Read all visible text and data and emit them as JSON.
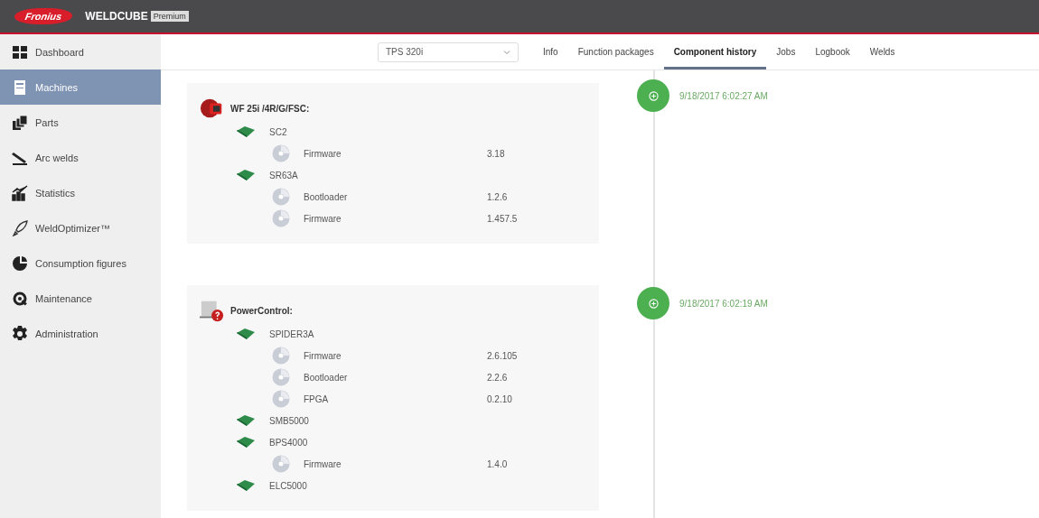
{
  "header": {
    "logo": "Fronius",
    "product": "WELDCUBE",
    "edition": "Premium"
  },
  "sidebar": {
    "items": [
      {
        "label": "Dashboard",
        "selected": false
      },
      {
        "label": "Machines",
        "selected": true
      },
      {
        "label": "Parts",
        "selected": false
      },
      {
        "label": "Arc welds",
        "selected": false
      },
      {
        "label": "Statistics",
        "selected": false
      },
      {
        "label": "WeldOptimizer™",
        "selected": false
      },
      {
        "label": "Consumption figures",
        "selected": false
      },
      {
        "label": "Maintenance",
        "selected": false
      },
      {
        "label": "Administration",
        "selected": false
      }
    ]
  },
  "machine_select": {
    "value": "TPS 320i"
  },
  "tabs": [
    {
      "label": "Info",
      "selected": false
    },
    {
      "label": "Function packages",
      "selected": false
    },
    {
      "label": "Component history",
      "selected": true
    },
    {
      "label": "Jobs",
      "selected": false
    },
    {
      "label": "Logbook",
      "selected": false
    },
    {
      "label": "Welds",
      "selected": false
    }
  ],
  "history": [
    {
      "timestamp": "9/18/2017 6:02:27 AM",
      "device": {
        "name": "WF 25i /4R/G/FSC:",
        "kind": "wirefeeder"
      },
      "components": [
        {
          "name": "SC2",
          "software": [
            {
              "name": "Firmware",
              "version": "3.18"
            }
          ]
        },
        {
          "name": "SR63A",
          "software": [
            {
              "name": "Bootloader",
              "version": "1.2.6"
            },
            {
              "name": "Firmware",
              "version": "1.457.5"
            }
          ]
        }
      ]
    },
    {
      "timestamp": "9/18/2017 6:02:19 AM",
      "device": {
        "name": "PowerControl:",
        "kind": "powercontrol"
      },
      "components": [
        {
          "name": "SPIDER3A",
          "software": [
            {
              "name": "Firmware",
              "version": "2.6.105"
            },
            {
              "name": "Bootloader",
              "version": "2.2.6"
            },
            {
              "name": "FPGA",
              "version": "0.2.10"
            }
          ]
        },
        {
          "name": "SMB5000"
        },
        {
          "name": "BPS4000",
          "software": [
            {
              "name": "Firmware",
              "version": "1.4.0"
            }
          ]
        },
        {
          "name": "ELC5000"
        }
      ]
    }
  ]
}
